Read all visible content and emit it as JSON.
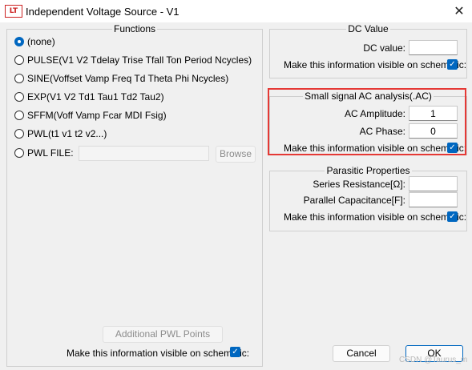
{
  "window": {
    "title": "Independent Voltage Source - V1",
    "icon_text": "LT",
    "close_glyph": "✕"
  },
  "functions": {
    "title": "Functions",
    "options": [
      {
        "label": "(none)",
        "selected": true
      },
      {
        "label": "PULSE(V1 V2 Tdelay Trise Tfall Ton Period Ncycles)",
        "selected": false
      },
      {
        "label": "SINE(Voffset Vamp Freq Td Theta Phi Ncycles)",
        "selected": false
      },
      {
        "label": "EXP(V1 V2 Td1 Tau1 Td2 Tau2)",
        "selected": false
      },
      {
        "label": "SFFM(Voff Vamp Fcar MDI Fsig)",
        "selected": false
      },
      {
        "label": "PWL(t1 v1 t2 v2...)",
        "selected": false
      },
      {
        "label": "PWL FILE:",
        "selected": false
      }
    ],
    "pwl_file_value": "",
    "browse_label": "Browse",
    "additional_pwl_label": "Additional PWL Points",
    "visible_label": "Make this information visible on schematic:",
    "visible_checked": true
  },
  "dc": {
    "title": "DC Value",
    "value_label": "DC value:",
    "value": "",
    "visible_label": "Make this information visible on schematic:",
    "visible_checked": true
  },
  "ac": {
    "title": "Small signal AC analysis(.AC)",
    "amplitude_label": "AC Amplitude:",
    "amplitude": "1",
    "phase_label": "AC Phase:",
    "phase": "0",
    "visible_label": "Make this information visible on schematic:",
    "visible_checked": true
  },
  "parasitic": {
    "title": "Parasitic Properties",
    "series_label": "Series Resistance[Ω]:",
    "series_value": "",
    "parallel_label": "Parallel Capacitance[F]:",
    "parallel_value": "",
    "visible_label": "Make this information visible on schematic:",
    "visible_checked": true
  },
  "buttons": {
    "cancel": "Cancel",
    "ok": "OK"
  },
  "watermark": "CSDN @Taurus_m",
  "colors": {
    "accent": "#0067c0",
    "highlight": "#e53935"
  },
  "check_glyph": "✓"
}
